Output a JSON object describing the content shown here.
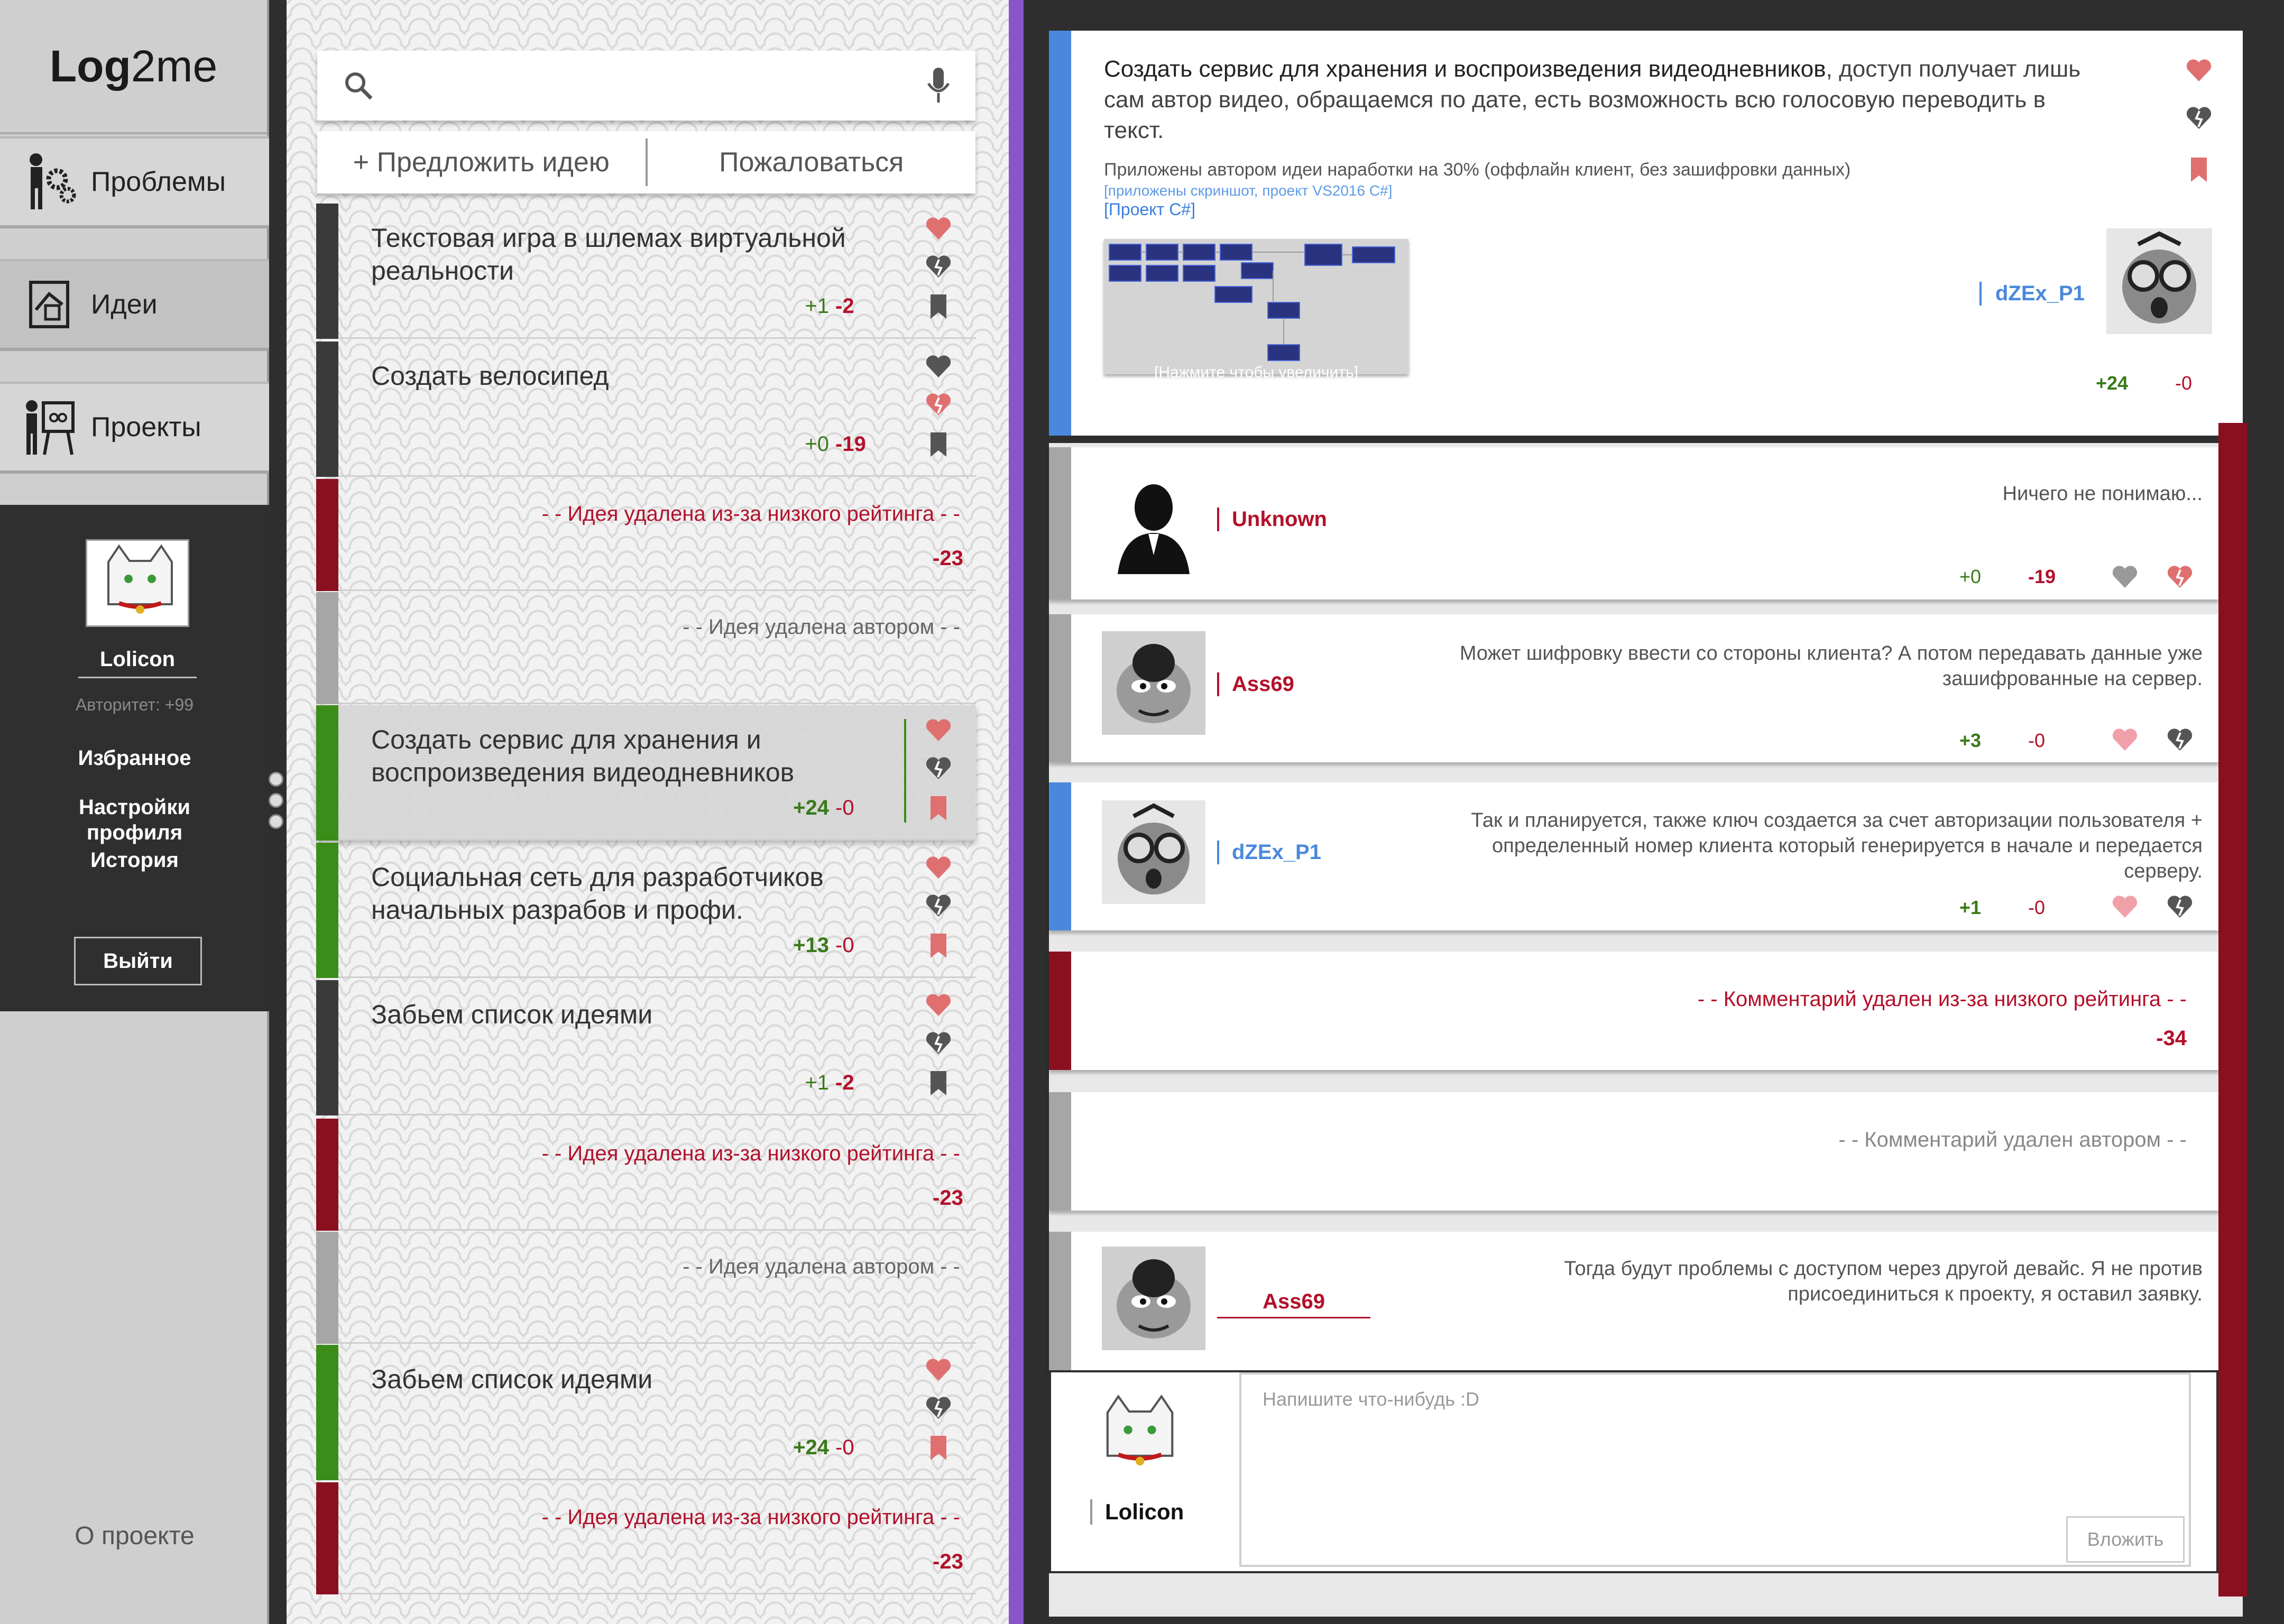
{
  "app": {
    "logo_bold": "Log",
    "logo_rest": "2me"
  },
  "sidebar": {
    "items": [
      {
        "label": "Проблемы",
        "icon": "gears-person-icon"
      },
      {
        "label": "Идеи",
        "icon": "idea-board-icon"
      },
      {
        "label": "Проекты",
        "icon": "presentation-icon"
      }
    ],
    "profile": {
      "name": "Lolicon",
      "rating": "Авторитет: +99",
      "links": [
        "Избранное",
        "Настройки профиля",
        "История"
      ],
      "logout": "Выйти"
    },
    "about": "О проекте"
  },
  "ideas": {
    "search_placeholder": "",
    "suggest": "+ Предложить идею",
    "complain": "Пожаловаться",
    "list": [
      {
        "title": "Текстовая игра в шлемах виртуальной реальности",
        "plus": "+1",
        "minus": "-2",
        "status": "active",
        "color": "#3a3a3a"
      },
      {
        "title": "Создать велосипед",
        "plus": "+0",
        "minus": "-19",
        "status": "active",
        "color": "#3a3a3a"
      },
      {
        "notice": "- - Идея удалена из-за низкого рейтинга - -",
        "score": "-23",
        "status": "deleted-rating",
        "color": "#8a1020"
      },
      {
        "notice": "- - Идея удалена автором - -",
        "status": "deleted-author",
        "color": "#a6a6a6"
      },
      {
        "title": "Создать сервис для хранения и воспроизведения видеодневников",
        "plus": "+24",
        "minus": "-0",
        "status": "selected",
        "color": "#3c8c1a"
      },
      {
        "title": "Социальная сеть для разработчиков начальных разрабов и профи.",
        "plus": "+13",
        "minus": "-0",
        "status": "active",
        "color": "#3c8c1a"
      },
      {
        "title": "Забьем список идеями",
        "plus": "+1",
        "minus": "-2",
        "status": "active",
        "color": "#3a3a3a"
      },
      {
        "notice": "- - Идея удалена из-за низкого рейтинга - -",
        "score": "-23",
        "status": "deleted-rating",
        "color": "#8a1020"
      },
      {
        "notice": "- - Идея удалена автором - -",
        "status": "deleted-author",
        "color": "#a6a6a6"
      },
      {
        "title": "Забьем список идеями",
        "plus": "+24",
        "minus": "-0",
        "status": "active",
        "color": "#3c8c1a"
      },
      {
        "notice": "- - Идея удалена из-за низкого рейтинга - -",
        "score": "-23",
        "status": "deleted-rating",
        "color": "#8a1020"
      }
    ]
  },
  "detail": {
    "title_main": "Создать сервис для хранения и воспроизведения видеодневников",
    "title_rest": ", доступ получает лишь сам автор видео, обращаемся по дате, есть возможность всю голосовую переводить в текст.",
    "note": "Приложены автором идеи наработки на 30% (оффлайн клиент, без зашифровки данных)",
    "attachments_hint": "[приложены скриншот, проект VS2016 C#]",
    "project_link": "[Проект C#]",
    "screenshot_caption": "[Нажмите чтобы увеличить]",
    "author": "dZEx_P1",
    "plus": "+24",
    "minus": "-0"
  },
  "comments": [
    {
      "author": "Unknown",
      "text": "Ничего не понимаю...",
      "plus": "+0",
      "minus": "-19",
      "color": "#b3102a"
    },
    {
      "author": "Ass69",
      "text": "Может шифровку ввести со стороны клиента? А потом передавать данные уже зашифрованные на сервер.",
      "plus": "+3",
      "minus": "-0",
      "color": "#b3102a"
    },
    {
      "author": "dZEx_P1",
      "text": "Так и планируется, также ключ создается за счет авторизации пользователя + определенный номер клиента который генерируется в начале и передается серверу.",
      "plus": "+1",
      "minus": "-0",
      "color": "#4a88dd"
    },
    {
      "notice": "- -  Комментарий удален из-за низкого рейтинга - -",
      "score": "-34"
    },
    {
      "notice": "- -  Комментарий удален автором - -"
    },
    {
      "author": "Ass69",
      "text": "Тогда будут проблемы с доступом через другой девайс. Я не против присоединиться к  проекту, я оставил заявку.",
      "color": "#b3102a"
    }
  ],
  "writer": {
    "placeholder": "Напишите что-нибудь :D",
    "button": "Вложить",
    "name": "Lolicon"
  }
}
